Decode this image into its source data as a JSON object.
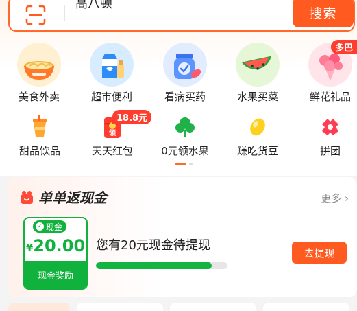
{
  "search": {
    "query": "高八顿",
    "button_label": "搜索",
    "scan_icon": "scan-icon"
  },
  "categories_row1": [
    {
      "label": "美食外卖",
      "icon": "noodle-bowl-icon"
    },
    {
      "label": "超市便利",
      "icon": "milk-carton-icon"
    },
    {
      "label": "看病买药",
      "icon": "medicine-bottle-icon"
    },
    {
      "label": "水果买菜",
      "icon": "watermelon-icon"
    },
    {
      "label": "鲜花礼品",
      "icon": "flower-bouquet-icon",
      "badge": "多巴"
    }
  ],
  "categories_row2": [
    {
      "label": "甜品饮品",
      "icon": "drink-cup-icon"
    },
    {
      "label": "天天红包",
      "icon": "red-packet-icon",
      "badge": "18.8元"
    },
    {
      "label": "0元领水果",
      "icon": "tree-icon"
    },
    {
      "label": "赚吃货豆",
      "icon": "bean-icon"
    },
    {
      "label": "拼团",
      "icon": "group-buy-icon"
    }
  ],
  "pager": {
    "pages": 2,
    "active": 1
  },
  "cashback": {
    "title": "单单返现金",
    "more_label": "更多",
    "coupon_tag": "现金",
    "currency": "¥",
    "amount": "20.00",
    "coupon_footer": "现金奖励",
    "message": "您有20元现金待提现",
    "progress": 0.88,
    "withdraw_label": "去提现"
  },
  "colors": {
    "accent": "#ff5a1f",
    "green": "#10b13c"
  }
}
